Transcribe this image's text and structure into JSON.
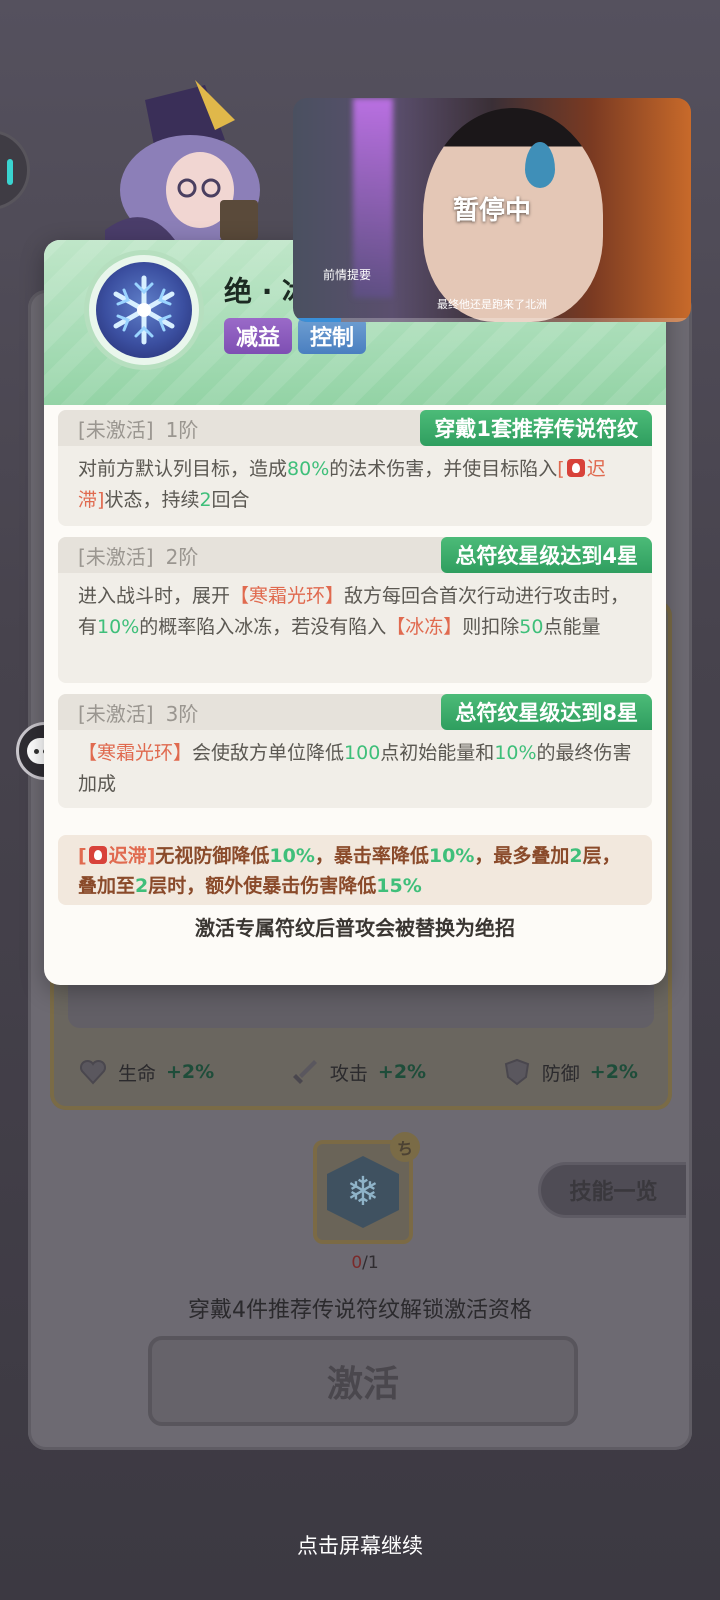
{
  "skill": {
    "name": "绝 · 冰",
    "tags": [
      "减益",
      "控制"
    ]
  },
  "tiers": [
    {
      "status": "[未激活]",
      "level": "1阶",
      "requirement": "穿戴1套推荐传说符纹",
      "desc": {
        "p1": "对前方默认列目标，造成",
        "v1": "80%",
        "p2": "的法术伤害，并使目标陷入",
        "b1": "[",
        "b1name": "迟滞",
        "b1end": "]",
        "p3": "状态，持续",
        "v2": "2",
        "p4": "回合"
      }
    },
    {
      "status": "[未激活]",
      "level": "2阶",
      "requirement": "总符纹星级达到4星",
      "desc": {
        "p1": "进入战斗时，展开",
        "r1": "【寒霜光环】",
        "p2": "敌方每回合首次行动进行攻击时，有",
        "v1": "10%",
        "p3": "的概率陷入冰冻，若没有陷入",
        "r2": "【冰冻】",
        "p4": "则扣除",
        "v2": "50",
        "p5": "点能量"
      }
    },
    {
      "status": "[未激活]",
      "level": "3阶",
      "requirement": "总符纹星级达到8星",
      "desc": {
        "r1": "【寒霜光环】",
        "p1": "会使敌方单位降低",
        "v1": "100",
        "p2": "点初始能量和",
        "v2": "10%",
        "p3": "的最终伤害加成"
      }
    }
  ],
  "note": {
    "b1": "[",
    "b1name": "迟滞",
    "b1end": "]",
    "p1": "无视防御降低",
    "v1": "10%",
    "p2": "，暴击率降低",
    "v2": "10%",
    "p3": "，最多叠加",
    "v3": "2",
    "p4": "层，叠加至",
    "v4": "2",
    "p5": "层时，额外使暴击伤害降低",
    "v5": "15%"
  },
  "footer_tip": "激活专属符纹后普攻会被替换为绝招",
  "background": {
    "stats": [
      {
        "label": "生命",
        "value": "+2%",
        "icon": "heart-icon"
      },
      {
        "label": "攻击",
        "value": "+2%",
        "icon": "sword-icon"
      },
      {
        "label": "防御",
        "value": "+2%",
        "icon": "shield-icon"
      }
    ],
    "skill_list_btn": "技能一览",
    "rune_count_current": "0",
    "rune_count_total": "/1",
    "unlock_tip": "穿戴4件推荐传说符纹解锁激活资格",
    "activate_btn": "激活",
    "continue_tip": "点击屏幕继续"
  },
  "video": {
    "paused_label": "暂停中",
    "recap_label": "前情提要",
    "subtitle": "最终他还是跑来了北洲",
    "progress": 0.12
  },
  "colors": {
    "accent_green": "#3fbf7a",
    "highlight_red": "#e06a4f",
    "requirement_bg": "#2f9e5f"
  }
}
